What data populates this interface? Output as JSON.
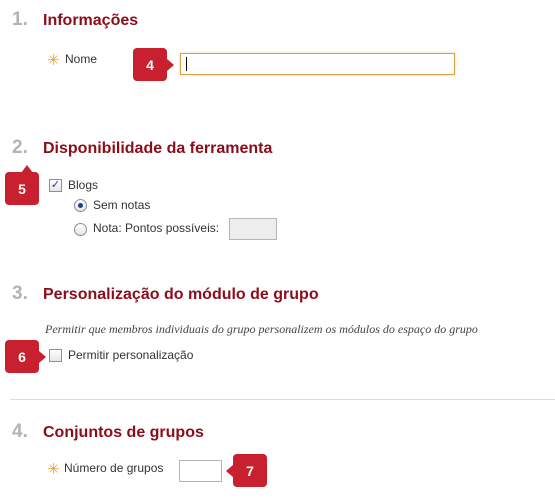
{
  "sections": [
    {
      "number": "1.",
      "title": "Informações"
    },
    {
      "number": "2.",
      "title": "Disponibilidade da ferramenta"
    },
    {
      "number": "3.",
      "title": "Personalização do módulo de grupo"
    },
    {
      "number": "4.",
      "title": "Conjuntos de grupos"
    }
  ],
  "info": {
    "required_mark": "✳",
    "name_label": "Nome",
    "name_value": ""
  },
  "availability": {
    "blogs_label": "Blogs",
    "blogs_checked": true,
    "option_no_grade": "Sem notas",
    "option_grade": "Nota: Pontos possíveis:",
    "selected_option": "Sem notas",
    "points_value": ""
  },
  "personalization": {
    "description": "Permitir que membros individuais do grupo personalizem os módulos do espaço do grupo",
    "checkbox_label": "Permitir personalização",
    "checked": false
  },
  "group_sets": {
    "required_mark": "✳",
    "count_label": "Número de grupos",
    "count_value": ""
  },
  "callouts": [
    "4",
    "5",
    "6",
    "7"
  ],
  "colors": {
    "callout": "#c8202f",
    "title": "#8b0d1a",
    "step_number": "#b3b3b3",
    "required": "#e8a23a"
  }
}
